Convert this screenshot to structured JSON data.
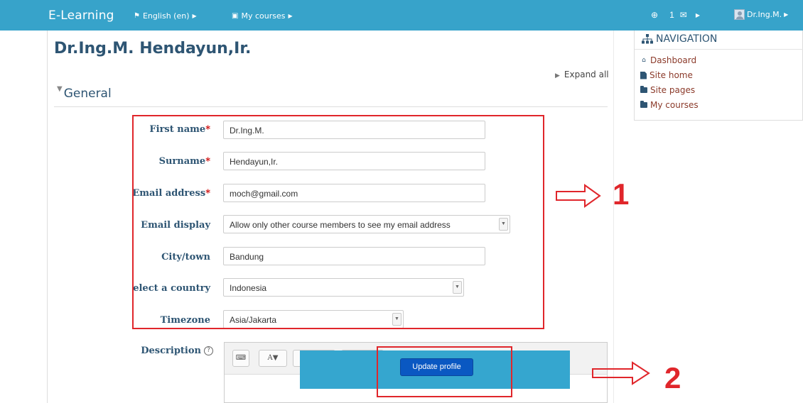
{
  "navbar": {
    "brand": "E-Learning",
    "language": "English (en)",
    "my_courses": "My courses",
    "message_count": "1",
    "user_name": "Dr.Ing.M."
  },
  "page": {
    "title": "Dr.Ing.M. Hendayun,Ir.",
    "expand_all": "Expand all",
    "section": "General"
  },
  "form": {
    "first_name": {
      "label": "First name",
      "value": "Dr.Ing.M."
    },
    "surname": {
      "label": "Surname",
      "value": "Hendayun,Ir."
    },
    "email": {
      "label": "Email address",
      "value": "moch@gmail.com"
    },
    "email_display": {
      "label": "Email display",
      "value": "Allow only other course members to see my email address"
    },
    "city": {
      "label": "City/town",
      "value": "Bandung"
    },
    "country": {
      "label": "elect a country",
      "value": "Indonesia"
    },
    "timezone": {
      "label": "Timezone",
      "value": "Asia/Jakarta"
    },
    "description": {
      "label": "Description"
    },
    "required_mark": "*"
  },
  "actions": {
    "update_profile": "Update profile"
  },
  "navigation": {
    "heading": "NAVIGATION",
    "items": [
      "Dashboard",
      "Site home",
      "Site pages",
      "My courses"
    ]
  },
  "annotations": {
    "one": "1",
    "two": "2",
    "color": "#e0262b"
  },
  "colors": {
    "navbar": "#37a3ca",
    "heading": "#2e5573",
    "link": "#8b3a2a",
    "button": "#0a58c2"
  }
}
